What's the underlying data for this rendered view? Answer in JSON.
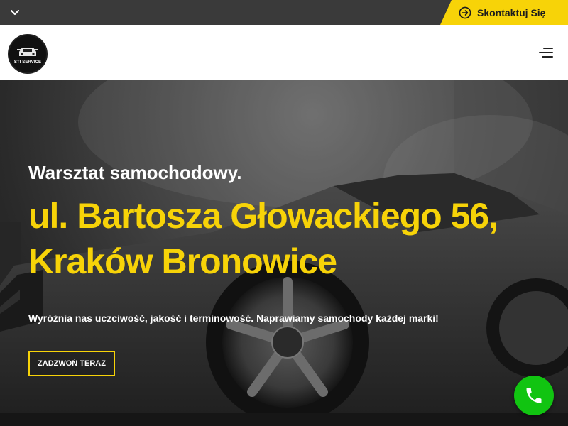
{
  "topbar": {
    "toggle_icon": "chevron-down-icon",
    "contact_label": "Skontaktuj Się",
    "contact_icon": "arrow-right-circle-icon",
    "accent_color": "#f7d308"
  },
  "header": {
    "logo_text": "STI SERVICE",
    "menu_icon": "hamburger-menu-icon"
  },
  "hero": {
    "subtitle": "Warsztat samochodowy.",
    "title": "ul. Bartosza Głowackiego 56, Kraków Bronowice",
    "description": "Wyróżnia nas uczciwość, jakość i terminowość. Naprawiamy samochody każdej marki!",
    "cta_label": "ZADZWOŃ TERAZ"
  },
  "floating": {
    "call_icon": "phone-icon",
    "call_color": "#11c411"
  }
}
